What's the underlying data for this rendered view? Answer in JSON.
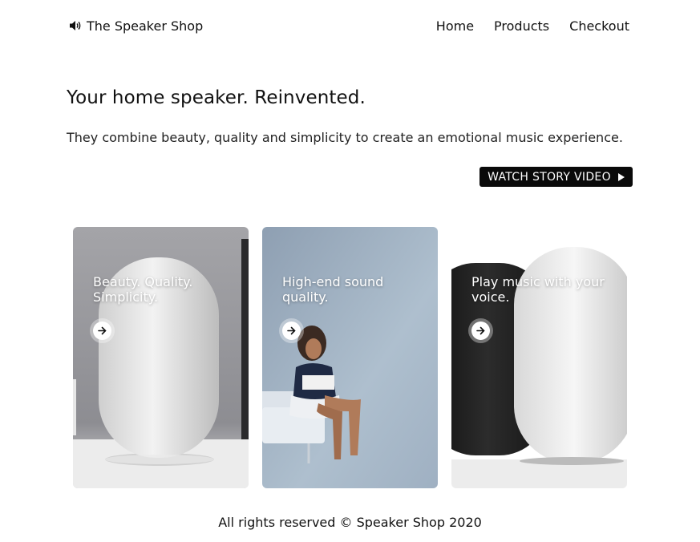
{
  "nav": {
    "brand": "The Speaker Shop",
    "brand_icon": "speaker-volume-icon",
    "links": [
      "Home",
      "Products",
      "Checkout"
    ]
  },
  "hero": {
    "title": "Your home speaker. Reinvented.",
    "subtitle": "They combine beauty, quality and simplicity to create an emotional music experience.",
    "cta": "WATCH STORY VIDEO",
    "cta_icon": "play-icon"
  },
  "cards": [
    {
      "caption": "Beauty. Quality. Simplicity.",
      "icon": "arrow-right-icon"
    },
    {
      "caption": "High-end sound quality.",
      "icon": "arrow-right-icon"
    },
    {
      "caption": "Play music with your voice.",
      "icon": "arrow-right-icon"
    }
  ],
  "footer": {
    "text": "All rights reserved © Speaker Shop 2020"
  }
}
